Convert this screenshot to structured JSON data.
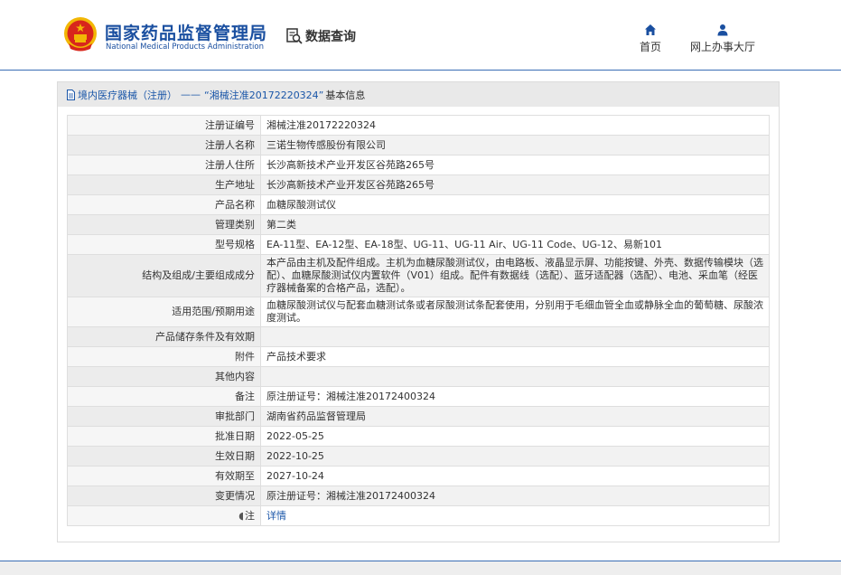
{
  "header": {
    "logo_cn": "国家药品监督管理局",
    "logo_en": "National Medical Products Administration",
    "query_label": "数据查询",
    "nav": [
      {
        "label": "首页",
        "icon": "home-icon"
      },
      {
        "label": "网上办事大厅",
        "icon": "user-icon"
      }
    ]
  },
  "panel": {
    "breadcrumb_link": "境内医疗器械（注册）",
    "breadcrumb_sep": "——",
    "breadcrumb_current": "“湘械注准20172220324”",
    "breadcrumb_suffix": "基本信息"
  },
  "rows": [
    {
      "label": "注册证编号",
      "value": "湘械注准20172220324"
    },
    {
      "label": "注册人名称",
      "value": "三诺生物传感股份有限公司"
    },
    {
      "label": "注册人住所",
      "value": "长沙高新技术产业开发区谷苑路265号"
    },
    {
      "label": "生产地址",
      "value": "长沙高新技术产业开发区谷苑路265号"
    },
    {
      "label": "产品名称",
      "value": "血糖尿酸测试仪"
    },
    {
      "label": "管理类别",
      "value": "第二类"
    },
    {
      "label": "型号规格",
      "value": "EA-11型、EA-12型、EA-18型、UG-11、UG-11 Air、UG-11 Code、UG-12、易新101"
    },
    {
      "label": "结构及组成/主要组成成分",
      "value": "本产品由主机及配件组成。主机为血糖尿酸测试仪，由电路板、液晶显示屏、功能按键、外壳、数据传输模块（选配）、血糖尿酸测试仪内置软件（V01）组成。配件有数据线（选配）、蓝牙适配器（选配）、电池、采血笔（经医疗器械备案的合格产品，选配）。"
    },
    {
      "label": "适用范围/预期用途",
      "value": "血糖尿酸测试仪与配套血糖测试条或者尿酸测试条配套使用，分别用于毛细血管全血或静脉全血的葡萄糖、尿酸浓度测试。"
    },
    {
      "label": "产品储存条件及有效期",
      "value": ""
    },
    {
      "label": "附件",
      "value": "产品技术要求"
    },
    {
      "label": "其他内容",
      "value": ""
    },
    {
      "label": "备注",
      "value": "原注册证号：湘械注准20172400324"
    },
    {
      "label": "审批部门",
      "value": "湖南省药品监督管理局"
    },
    {
      "label": "批准日期",
      "value": "2022-05-25"
    },
    {
      "label": "生效日期",
      "value": "2022-10-25"
    },
    {
      "label": "有效期至",
      "value": "2027-10-24"
    },
    {
      "label": "变更情况",
      "value": "原注册证号：湘械注准20172400324"
    },
    {
      "label": "注",
      "value": "详情"
    }
  ],
  "colors": {
    "brand_blue": "#1a4fa0",
    "link_blue": "#1a56a8",
    "emblem_red": "#d8261c",
    "emblem_gold": "#f2b705"
  }
}
